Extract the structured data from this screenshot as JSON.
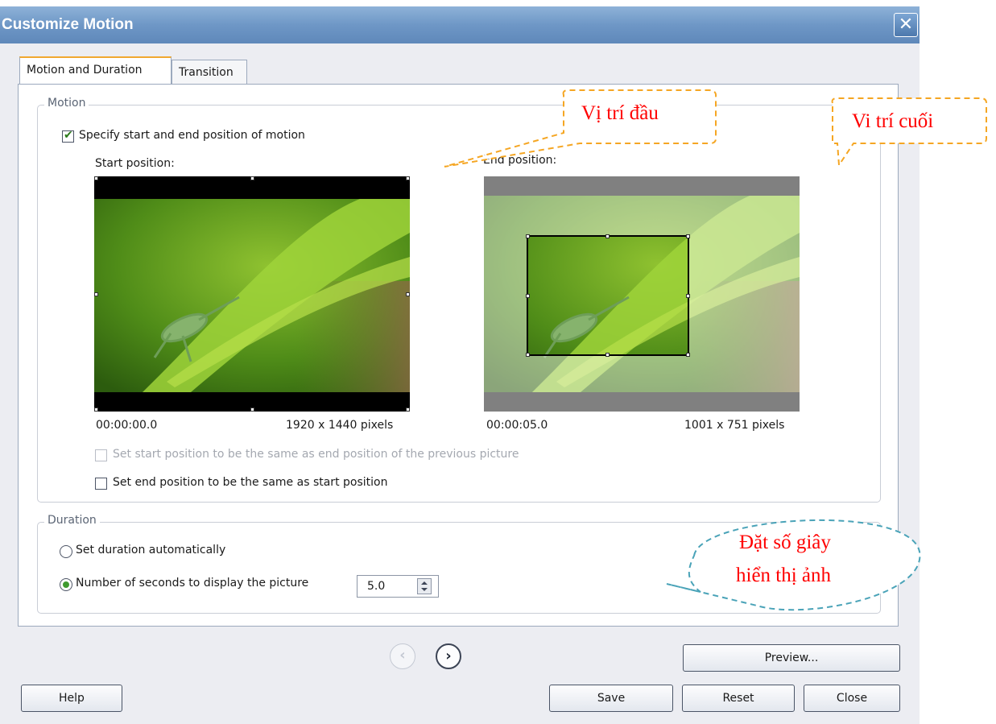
{
  "window": {
    "title": "Customize Motion",
    "close_glyph": "✕"
  },
  "tabs": [
    {
      "label": "Motion and Duration",
      "active": true
    },
    {
      "label": "Transition",
      "active": false
    }
  ],
  "motion": {
    "legend": "Motion",
    "specify_checkbox": {
      "label": "Specify start and end position of motion",
      "checked": true
    },
    "start": {
      "label": "Start position:",
      "time": "00:00:00.0",
      "size": "1920 x 1440 pixels"
    },
    "end": {
      "label": "End position:",
      "time": "00:00:05.0",
      "size": "1001 x 751 pixels"
    },
    "same_as_previous": {
      "label": "Set start position to be the same as end position of the previous picture",
      "checked": false,
      "enabled": false
    },
    "end_same_as_start": {
      "label": "Set end position to be the same as start position",
      "checked": false,
      "enabled": true
    }
  },
  "duration": {
    "legend": "Duration",
    "auto": {
      "label": "Set duration automatically",
      "selected": false
    },
    "manual": {
      "label": "Number of seconds to display the picture",
      "selected": true
    },
    "seconds_value": "5.0"
  },
  "nav": {
    "prev_glyph": "‹",
    "next_glyph": "›"
  },
  "buttons": {
    "preview": "Preview...",
    "help": "Help",
    "save": "Save",
    "reset": "Reset",
    "close": "Close"
  },
  "annotations": {
    "start_callout": "Vị trí đầu",
    "end_callout": "Vi trí cuối",
    "duration_callout_line1": "Đặt số giây",
    "duration_callout_line2": "hiển thị ảnh",
    "color": "#ff0000",
    "border_color": "#f5a623",
    "duration_border_color": "#4aa3b8"
  },
  "colors": {
    "titlebar": "#6e97c6",
    "accent_check": "#3f9a2f",
    "tab_accent": "#f0a830"
  }
}
